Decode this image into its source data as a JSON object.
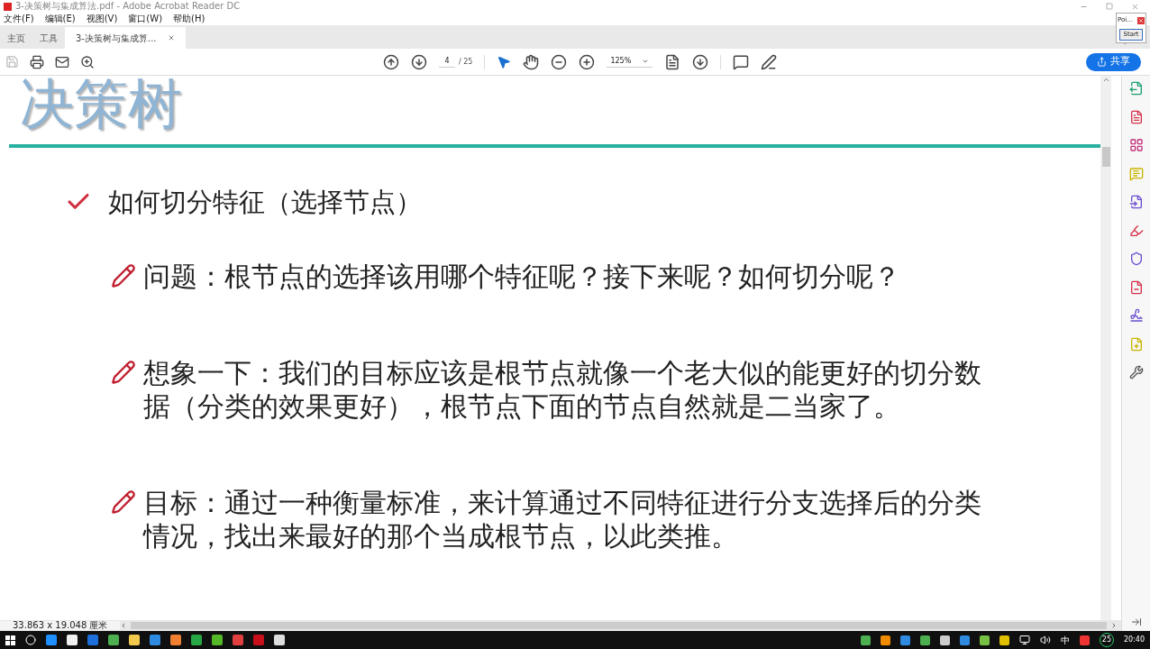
{
  "window": {
    "title": "3-决策树与集成算法.pdf - Adobe Acrobat Reader DC"
  },
  "menu": [
    "文件(F)",
    "编辑(E)",
    "视图(V)",
    "窗口(W)",
    "帮助(H)"
  ],
  "tabs": [
    {
      "label": "主页",
      "selected": false,
      "closable": false
    },
    {
      "label": "工具",
      "selected": false,
      "closable": false
    },
    {
      "label": "3-决策树与集成算...",
      "selected": true,
      "closable": true
    }
  ],
  "popup": {
    "title": "Poi...",
    "button": "Start"
  },
  "toolbar": {
    "page": "4",
    "page_total": "/ 25",
    "zoom": "125%",
    "share": "共享"
  },
  "slide": {
    "title": "决策树",
    "heading": "如何切分特征（选择节点）",
    "bullets": [
      "问题：根节点的选择该用哪个特征呢？接下来呢？如何切分呢？",
      "想象一下：我们的目标应该是根节点就像一个老大似的能更好的切分数据（分类的效果更好），根节点下面的节点自然就是二当家了。",
      "目标：通过一种衡量标准，来计算通过不同特征进行分支选择后的分类情况，找出来最好的那个当成根节点，以此类推。"
    ]
  },
  "status_bar": {
    "page_size": "33.863 x 19.048 厘米"
  },
  "taskbar": {
    "ime": "中",
    "badge": "25",
    "clock": "20:40"
  }
}
